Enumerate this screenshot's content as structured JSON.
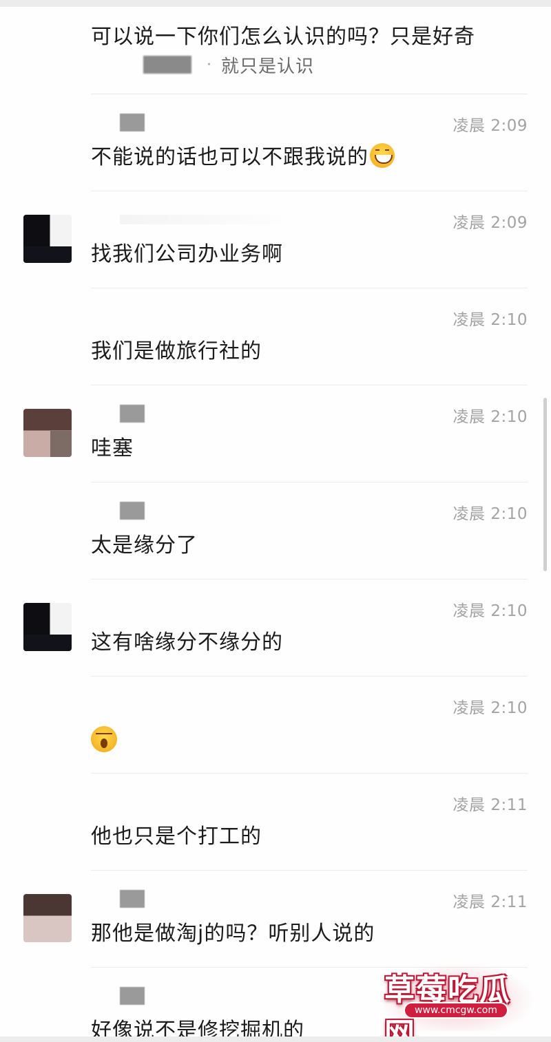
{
  "top_fragment": {
    "text": "可以说一下你们怎么认识的吗？只是好奇",
    "reply_text": "就只是认识"
  },
  "messages": [
    {
      "avatar": "none",
      "time": "凌晨 2:09",
      "text": "不能说的话也可以不跟我说的",
      "emoji": "grinning-emoji"
    },
    {
      "avatar": "dark",
      "time": "凌晨 2:09",
      "text": "找我们公司办业务啊"
    },
    {
      "avatar": "none",
      "time": "凌晨 2:10",
      "text": "我们是做旅行社的"
    },
    {
      "avatar": "pink",
      "time": "凌晨 2:10",
      "text": "哇塞"
    },
    {
      "avatar": "none",
      "time": "凌晨 2:10",
      "text": "太是缘分了"
    },
    {
      "avatar": "dark",
      "time": "凌晨 2:10",
      "text": "这有啥缘分不缘分的"
    },
    {
      "avatar": "none",
      "time": "凌晨 2:10",
      "text": "",
      "emoji": "yawn-emoji"
    },
    {
      "avatar": "none",
      "time": "凌晨 2:11",
      "text": "他也只是个打工的"
    },
    {
      "avatar": "pink2",
      "time": "凌晨 2:11",
      "text": "那他是做淘j的吗？听别人说的"
    },
    {
      "avatar": "none",
      "time": "",
      "text": "好像说不是修挖掘机的"
    }
  ],
  "watermark": {
    "title": "草莓吃瓜网",
    "url": "www.cmcgw.com"
  }
}
